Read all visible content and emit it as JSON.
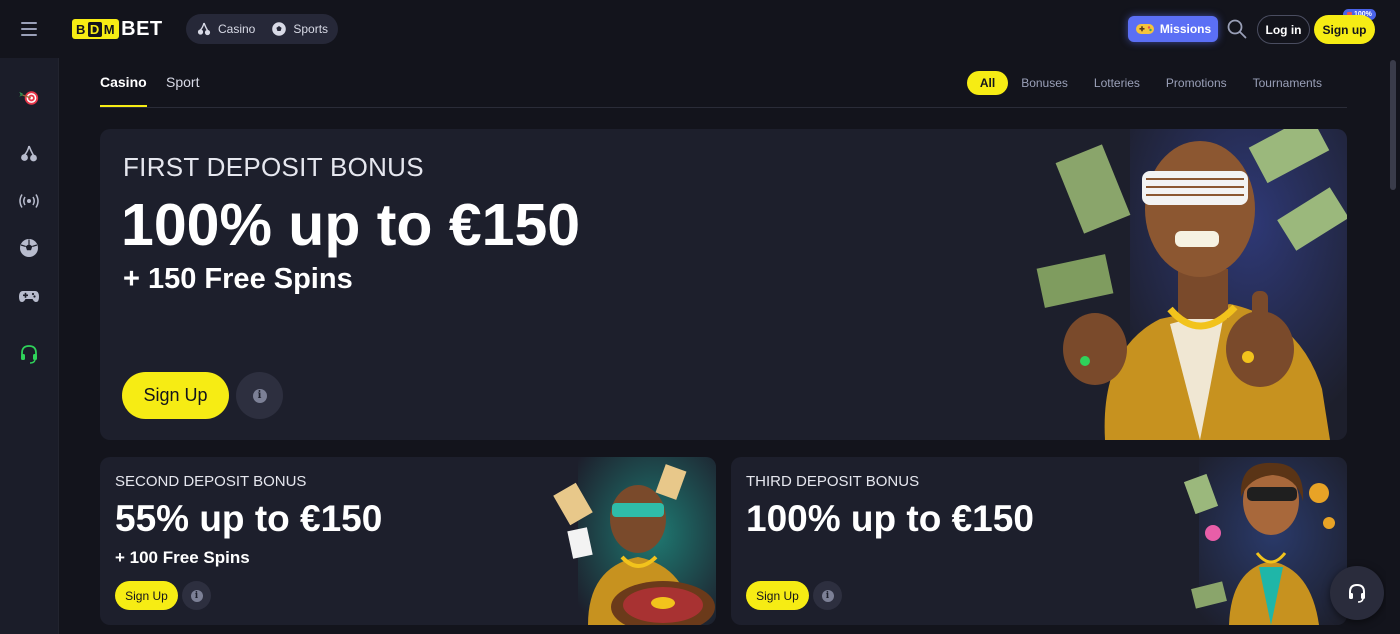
{
  "header": {
    "menu_icon": "hamburger-icon",
    "logo": {
      "box_letters": [
        "B",
        "D",
        "M"
      ],
      "suffix": "BET"
    },
    "nav": [
      {
        "label": "Casino",
        "icon": "cherry-icon"
      },
      {
        "label": "Sports",
        "icon": "soccer-ball-icon"
      }
    ],
    "missions_label": "Missions",
    "missions_badge": "100%",
    "login_label": "Log in",
    "signup_label": "Sign up"
  },
  "sidebar": {
    "items": [
      "darts-target-icon",
      "cherry-icon",
      "live-broadcast-icon",
      "soccer-ball-icon",
      "gamepad-icon",
      "headset-icon"
    ]
  },
  "subtabs": {
    "casino": "Casino",
    "sport": "Sport"
  },
  "filters": [
    "All",
    "Bonuses",
    "Lotteries",
    "Promotions",
    "Tournaments"
  ],
  "banners": {
    "first": {
      "eyebrow": "FIRST DEPOSIT BONUS",
      "title": "100% up to €150",
      "subtitle": "+ 150 Free Spins",
      "button": "Sign Up",
      "info": "i"
    },
    "second": {
      "eyebrow": "SECOND DEPOSIT BONUS",
      "title": "55% up to €150",
      "subtitle": "+ 100 Free Spins",
      "button": "Sign Up",
      "info": "i"
    },
    "third": {
      "eyebrow": "THIRD DEPOSIT BONUS",
      "title": "100% up to €150",
      "button": "Sign Up",
      "info": "i"
    }
  },
  "colors": {
    "accent": "#f6ec14",
    "missions": "#5b6ff5",
    "background": "#13141c",
    "card": "#1d1f2c"
  }
}
